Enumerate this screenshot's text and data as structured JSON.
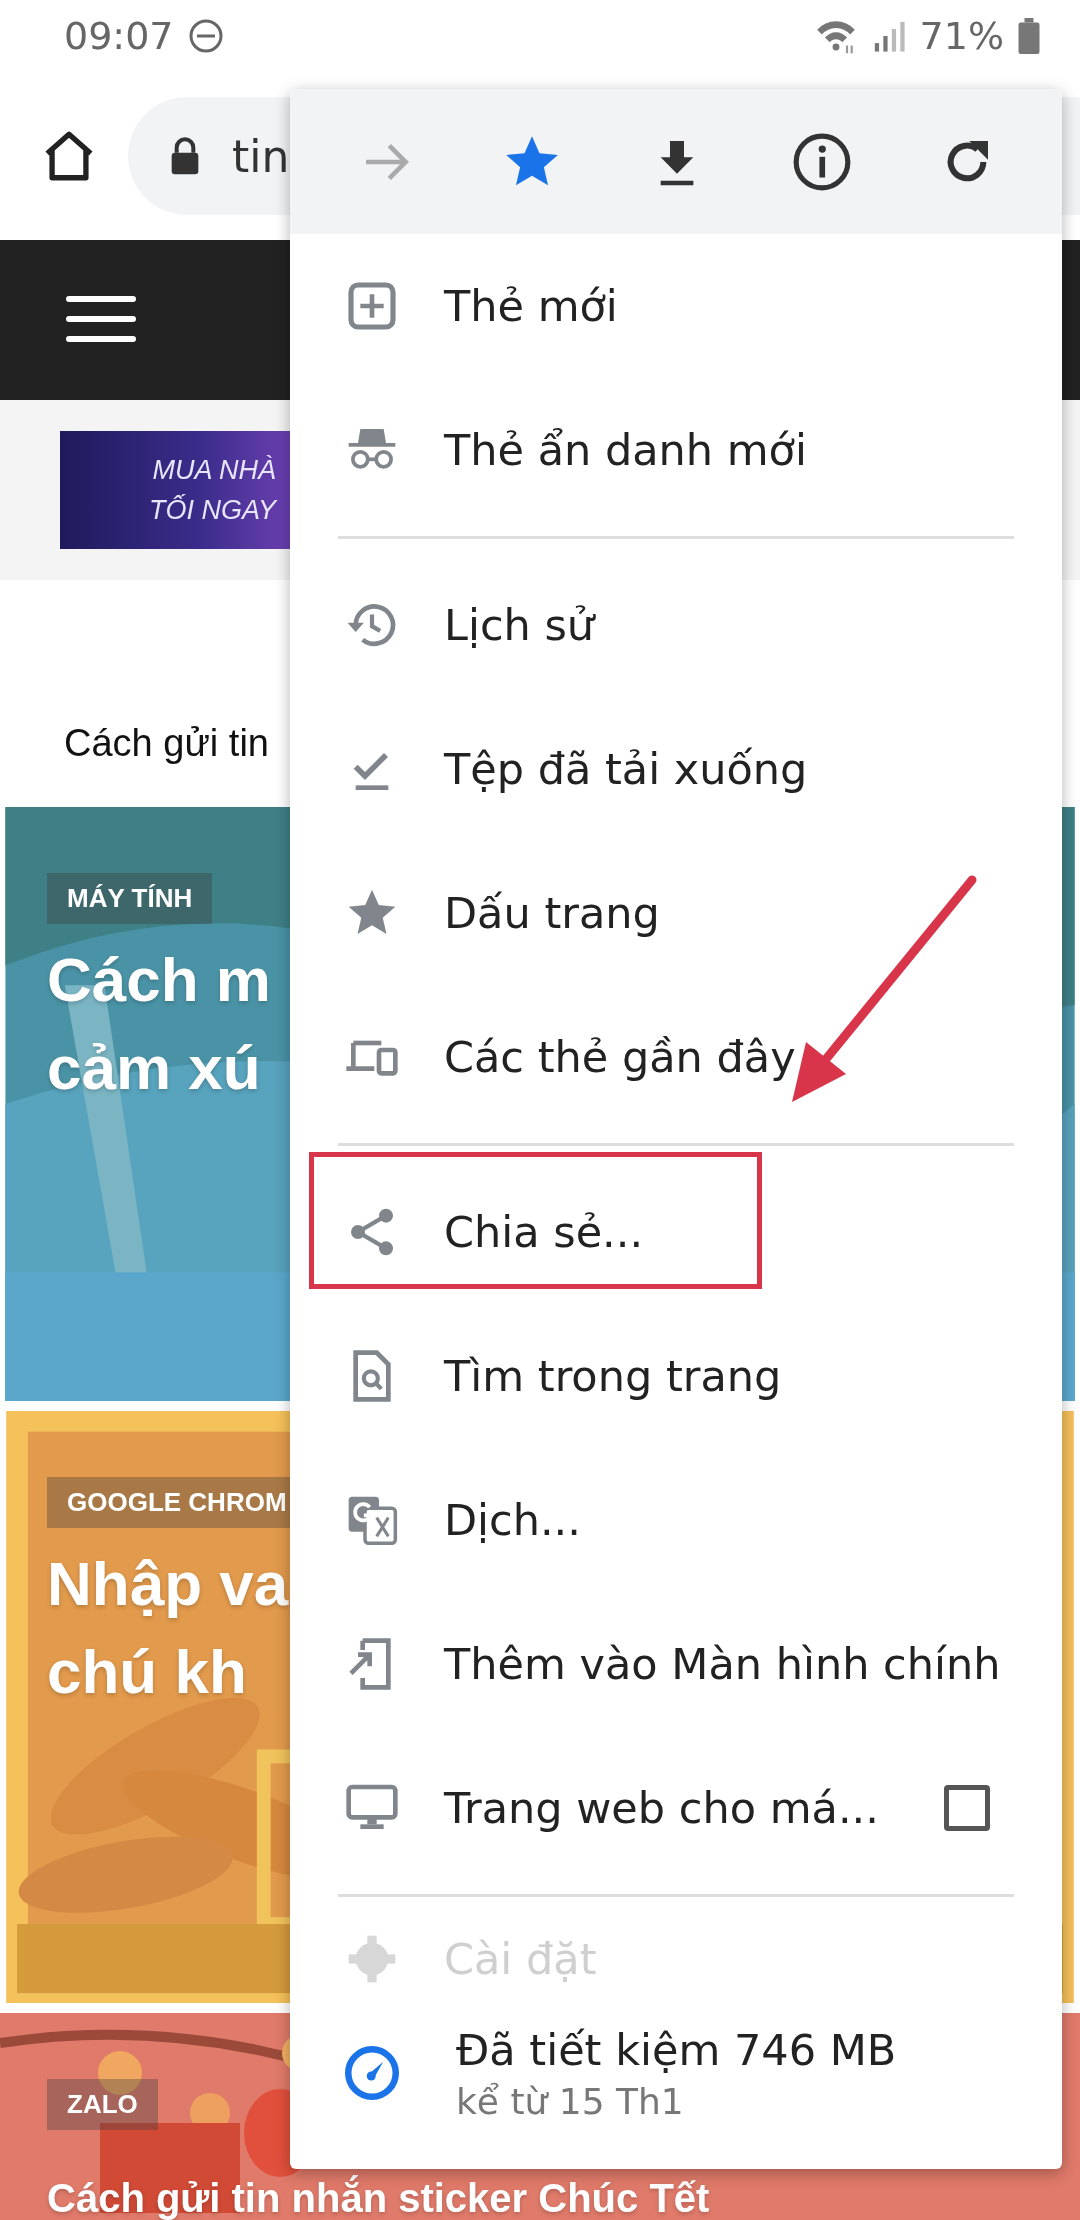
{
  "status_bar": {
    "time": "09:07",
    "battery": "71%"
  },
  "toolbar": {
    "url": "tin"
  },
  "ad": {
    "lines": [
      "MUA NHÀ",
      "TỐI NGAY"
    ]
  },
  "headline": "Cách gửi tin",
  "cards": [
    {
      "kind": "teal",
      "category": "MÁY TÍNH",
      "title_lines": [
        "Cách m",
        "cảm xú"
      ]
    },
    {
      "kind": "orange",
      "category": "GOOGLE CHROM",
      "title_lines": [
        "Nhập va",
        "chú kh"
      ]
    },
    {
      "kind": "red",
      "category": "ZALO",
      "title_lines": [
        "Cách gửi tin nhắn sticker Chúc Tết"
      ]
    }
  ],
  "menu": {
    "actions": [
      {
        "kind": "forward",
        "disabled": true
      },
      {
        "kind": "bookmark",
        "on": true
      },
      {
        "kind": "download"
      },
      {
        "kind": "info"
      },
      {
        "kind": "reload"
      }
    ],
    "items": [
      {
        "kind": "item",
        "label": "Thẻ mới",
        "highlighted": false
      },
      {
        "kind": "item",
        "label": "Thẻ ẩn danh mới",
        "highlighted": false
      },
      {
        "kind": "divider"
      },
      {
        "kind": "item",
        "label": "Lịch sử",
        "highlighted": false
      },
      {
        "kind": "item",
        "label": "Tệp đã tải xuống",
        "highlighted": false
      },
      {
        "kind": "item",
        "label": "Dấu trang",
        "highlighted": false
      },
      {
        "kind": "item",
        "label": "Các thẻ gần đây",
        "highlighted": false
      },
      {
        "kind": "divider"
      },
      {
        "kind": "item",
        "label": "Chia sẻ...",
        "highlighted": true
      },
      {
        "kind": "item",
        "label": "Tìm trong trang",
        "highlighted": false
      },
      {
        "kind": "item",
        "label": "Dịch...",
        "highlighted": false
      },
      {
        "kind": "item",
        "label": "Thêm vào Màn hình chính",
        "highlighted": false
      },
      {
        "kind": "checkbox",
        "label": "Trang web cho má...",
        "checked": false
      },
      {
        "kind": "divider"
      },
      {
        "kind": "faded",
        "label": "Cài đặt"
      }
    ],
    "footer": {
      "title": "Đã tiết kiệm 746 MB",
      "subtitle": "kể từ 15 Th1"
    }
  }
}
